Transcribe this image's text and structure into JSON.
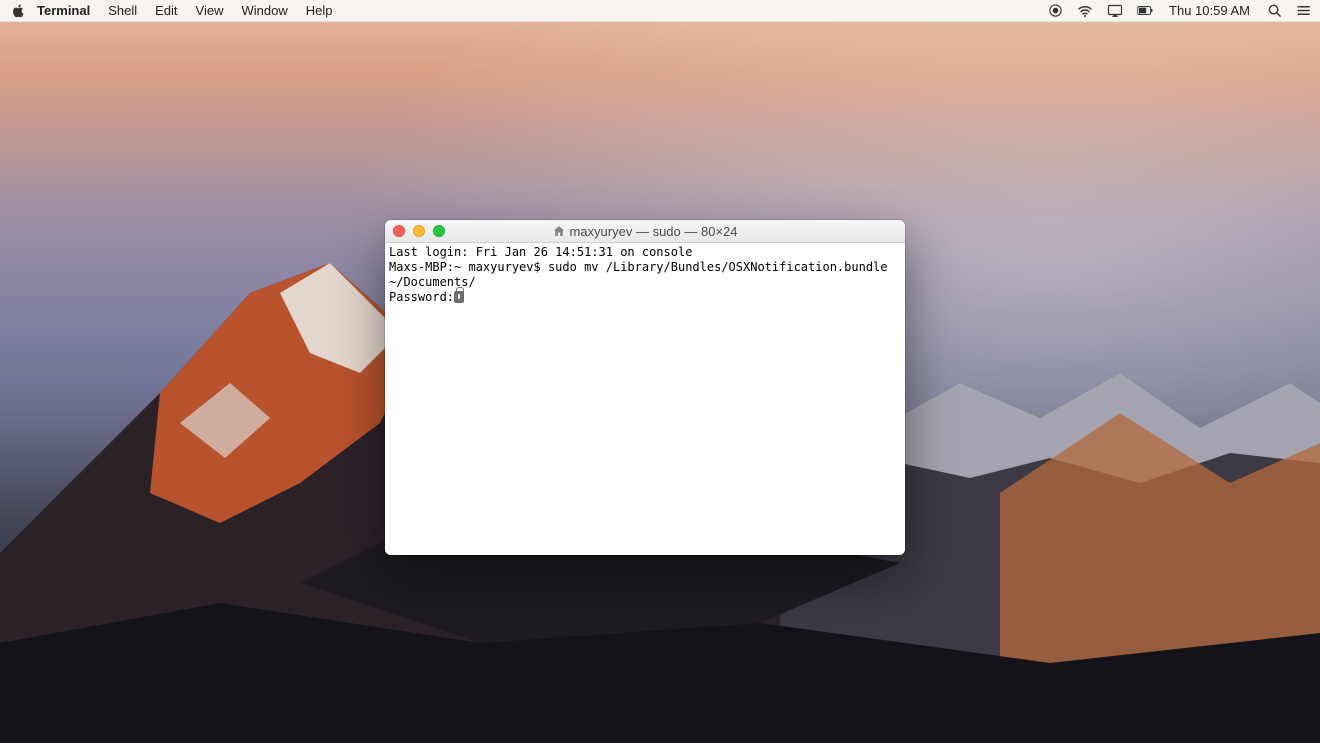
{
  "menubar": {
    "app_name": "Terminal",
    "items": [
      "Shell",
      "Edit",
      "View",
      "Window",
      "Help"
    ],
    "clock": "Thu 10:59 AM"
  },
  "window": {
    "title": "maxyuryev — sudo — 80×24"
  },
  "terminal": {
    "line1": "Last login: Fri Jan 26 14:51:31 on console",
    "line2": "Maxs-MBP:~ maxyuryev$ sudo mv /Library/Bundles/OSXNotification.bundle ~/Documents/",
    "line3_label": "Password:"
  }
}
